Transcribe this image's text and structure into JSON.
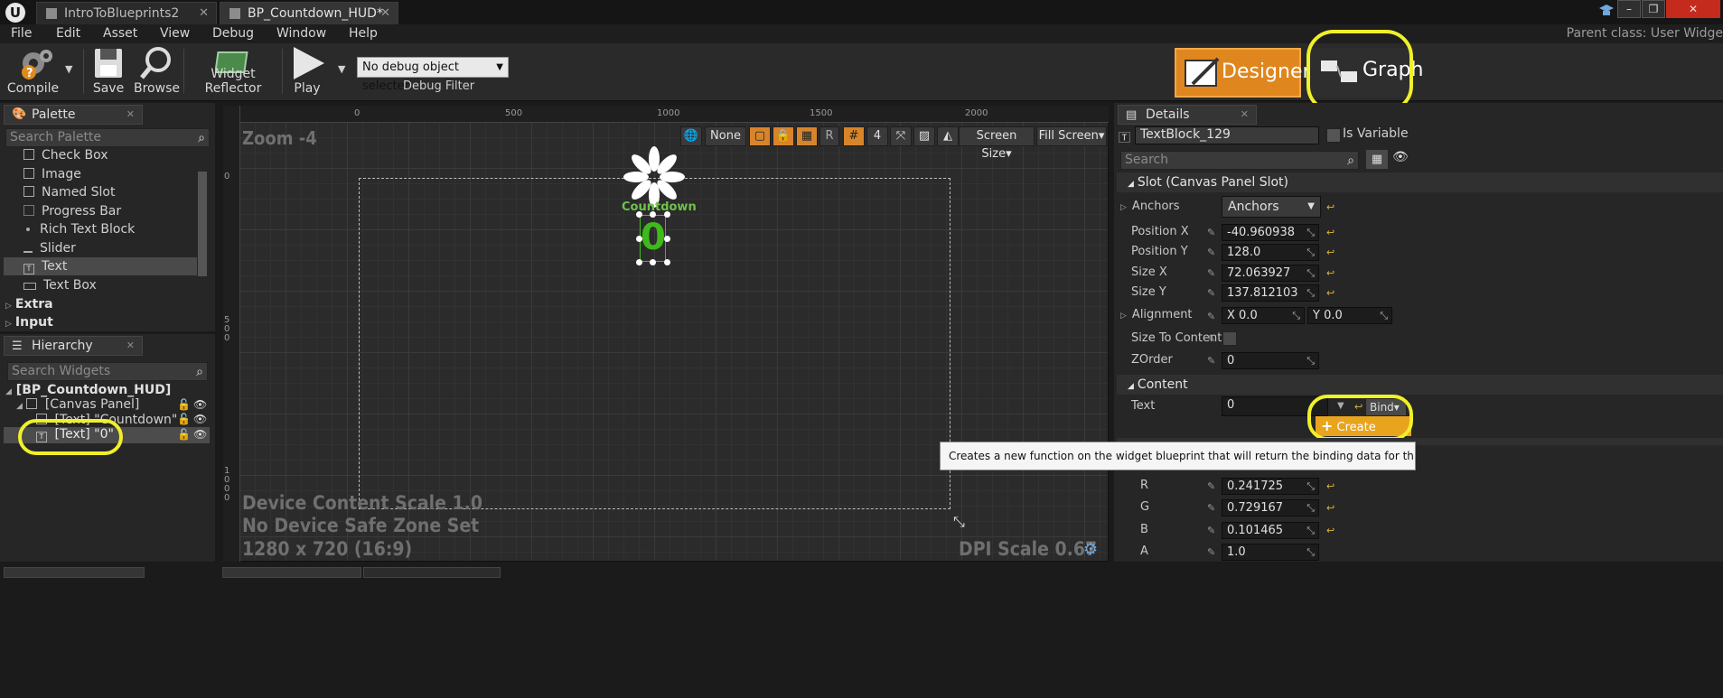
{
  "tabs": [
    {
      "label": "IntroToBlueprints2"
    },
    {
      "label": "BP_Countdown_HUD*"
    }
  ],
  "menu": [
    "File",
    "Edit",
    "Asset",
    "View",
    "Debug",
    "Window",
    "Help"
  ],
  "parent_class": "Parent class: User Widge",
  "toolbar": {
    "compile": "Compile",
    "save": "Save",
    "browse": "Browse",
    "widget_reflector": "Widget Reflector",
    "play": "Play",
    "debug_object": "No debug object selected",
    "debug_filter": "Debug Filter"
  },
  "modes": {
    "designer": "Designer",
    "graph": "Graph"
  },
  "palette": {
    "title": "Palette",
    "search_placeholder": "Search Palette",
    "items": [
      "Check Box",
      "Image",
      "Named Slot",
      "Progress Bar",
      "Rich Text Block",
      "Slider",
      "Text",
      "Text Box"
    ],
    "categories": [
      "Extra",
      "Input"
    ]
  },
  "hierarchy": {
    "title": "Hierarchy",
    "search_placeholder": "Search Widgets",
    "root": "[BP_Countdown_HUD]",
    "canvas": "[Canvas Panel]",
    "text1": "[Text] \"Countdown\"",
    "text2": "[Text] \"0\""
  },
  "viewport": {
    "zoom": "Zoom -4",
    "tools": {
      "none": "None",
      "grid": "4",
      "r": "R",
      "screen_size": "Screen Size",
      "fill_screen": "Fill Screen"
    },
    "ruler_h": [
      "0",
      "500",
      "1000",
      "1500",
      "2000"
    ],
    "ruler_v": {
      "zero": "0",
      "five_hundred": "5\n0\n0",
      "thousand": "1\n0\n0\n0"
    },
    "countdown_label": "Countdown",
    "digit": "0",
    "device_scale": "Device Content Scale 1.0",
    "safe_zone": "No Device Safe Zone Set",
    "resolution": "1280 x 720 (16:9)",
    "dpi": "DPI Scale 0.67"
  },
  "details": {
    "title": "Details",
    "widget_name": "TextBlock_129",
    "is_variable": "Is Variable",
    "search_placeholder": "Search",
    "slot_section": "Slot (Canvas Panel Slot)",
    "anchors_label": "Anchors",
    "anchors_value": "Anchors",
    "position_x_label": "Position X",
    "position_x": "-40.960938",
    "position_y_label": "Position Y",
    "position_y": "128.0",
    "size_x_label": "Size X",
    "size_x": "72.063927",
    "size_y_label": "Size Y",
    "size_y": "137.812103",
    "alignment_label": "Alignment",
    "alignment_x": "X  0.0",
    "alignment_y": "Y  0.0",
    "size_to_content_label": "Size To Content",
    "zorder_label": "ZOrder",
    "zorder": "0",
    "content_section": "Content",
    "text_label": "Text",
    "text_value": "0",
    "bind": "Bind",
    "create_binding": "Create Bindin",
    "tooltip": "Creates a new function on the widget blueprint that will return the binding data for this property.",
    "r_label": "R",
    "r": "0.241725",
    "g_label": "G",
    "g": "0.729167",
    "b_label": "B",
    "b": "0.101465",
    "a_label": "A",
    "a": "1.0"
  },
  "colors": {
    "accent_orange": "#d8842a",
    "highlight_yellow": "#f0f02a",
    "text_green": "#3eba1a",
    "bind_button": "#e8a41c"
  }
}
